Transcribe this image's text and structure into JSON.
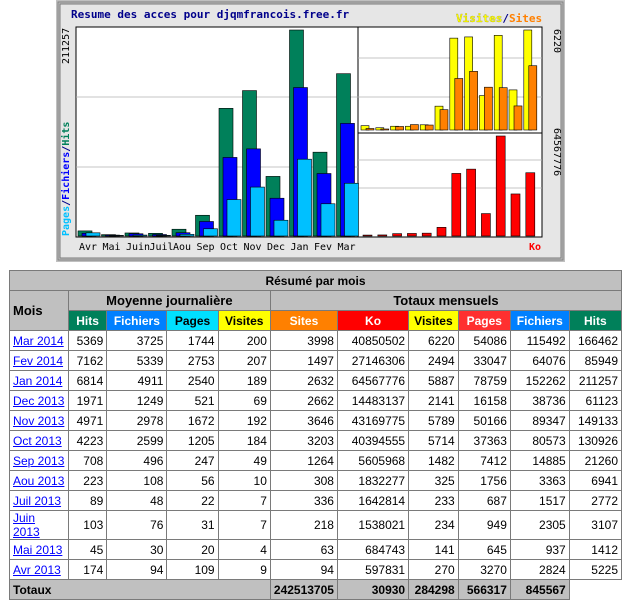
{
  "graph": {
    "title": "Resume des acces pour djqmfrancois.free.fr",
    "legend_left": "Pages/Fichiers/Hits",
    "legend_right_visites": "Visites",
    "legend_right_sep": "/",
    "legend_right_sites": "Sites",
    "left_max": "211257",
    "mid_max_visites": "6220",
    "mid_max_ko": "64567776",
    "ko_label": "Ko",
    "months": [
      "Avr",
      "Mai",
      "Juin",
      "Juil",
      "Aou",
      "Sep",
      "Oct",
      "Nov",
      "Dec",
      "Jan",
      "Fev",
      "Mar"
    ],
    "colors": {
      "hits": "#00805a",
      "fichiers": "#0000ff",
      "pages": "#00c0ff",
      "visites": "#ffff00",
      "sites": "#ff8000",
      "ko": "#ff0000",
      "bg": "#ffffff",
      "frame": "#c0c0c0"
    }
  },
  "table": {
    "title": "Résumé par mois",
    "mois_header": "Mois",
    "moy_header": "Moyenne journalière",
    "tot_header": "Totaux mensuels",
    "col_moy": [
      {
        "label": "Hits",
        "color": "#00805a",
        "dark": false
      },
      {
        "label": "Fichiers",
        "color": "#0080ff",
        "dark": false
      },
      {
        "label": "Pages",
        "color": "#00e0ff",
        "dark": true
      },
      {
        "label": "Visites",
        "color": "#ffff00",
        "dark": true
      }
    ],
    "col_tot": [
      {
        "label": "Sites",
        "color": "#ff8000",
        "dark": false
      },
      {
        "label": "Ko",
        "color": "#ff0000",
        "dark": false
      },
      {
        "label": "Visites",
        "color": "#ffff00",
        "dark": true
      },
      {
        "label": "Pages",
        "color": "#ff3030",
        "dark": false
      },
      {
        "label": "Fichiers",
        "color": "#0080ff",
        "dark": false
      },
      {
        "label": "Hits",
        "color": "#00805a",
        "dark": false
      }
    ],
    "rows": [
      {
        "mois": "Mar 2014",
        "vals": [
          "5369",
          "3725",
          "1744",
          "200",
          "3998",
          "40850502",
          "6220",
          "54086",
          "115492",
          "166462"
        ]
      },
      {
        "mois": "Fev 2014",
        "vals": [
          "7162",
          "5339",
          "2753",
          "207",
          "1497",
          "27146306",
          "2494",
          "33047",
          "64076",
          "85949"
        ]
      },
      {
        "mois": "Jan 2014",
        "vals": [
          "6814",
          "4911",
          "2540",
          "189",
          "2632",
          "64567776",
          "5887",
          "78759",
          "152262",
          "211257"
        ]
      },
      {
        "mois": "Dec 2013",
        "vals": [
          "1971",
          "1249",
          "521",
          "69",
          "2662",
          "14483137",
          "2141",
          "16158",
          "38736",
          "61123"
        ]
      },
      {
        "mois": "Nov 2013",
        "vals": [
          "4971",
          "2978",
          "1672",
          "192",
          "3646",
          "43169775",
          "5789",
          "50166",
          "89347",
          "149133"
        ]
      },
      {
        "mois": "Oct 2013",
        "vals": [
          "4223",
          "2599",
          "1205",
          "184",
          "3203",
          "40394555",
          "5714",
          "37363",
          "80573",
          "130926"
        ]
      },
      {
        "mois": "Sep 2013",
        "vals": [
          "708",
          "496",
          "247",
          "49",
          "1264",
          "5605968",
          "1482",
          "7412",
          "14885",
          "21260"
        ]
      },
      {
        "mois": "Aou 2013",
        "vals": [
          "223",
          "108",
          "56",
          "10",
          "308",
          "1832277",
          "325",
          "1756",
          "3363",
          "6941"
        ]
      },
      {
        "mois": "Juil 2013",
        "vals": [
          "89",
          "48",
          "22",
          "7",
          "336",
          "1642814",
          "233",
          "687",
          "1517",
          "2772"
        ]
      },
      {
        "mois": "Juin 2013",
        "vals": [
          "103",
          "76",
          "31",
          "7",
          "218",
          "1538021",
          "234",
          "949",
          "2305",
          "3107"
        ]
      },
      {
        "mois": "Mai 2013",
        "vals": [
          "45",
          "30",
          "20",
          "4",
          "63",
          "684743",
          "141",
          "645",
          "937",
          "1412"
        ]
      },
      {
        "mois": "Avr 2013",
        "vals": [
          "174",
          "94",
          "109",
          "9",
          "94",
          "597831",
          "270",
          "3270",
          "2824",
          "5225"
        ]
      }
    ],
    "totals_label": "Totaux",
    "totals": [
      "242513705",
      "30930",
      "284298",
      "566317",
      "845567"
    ]
  }
}
